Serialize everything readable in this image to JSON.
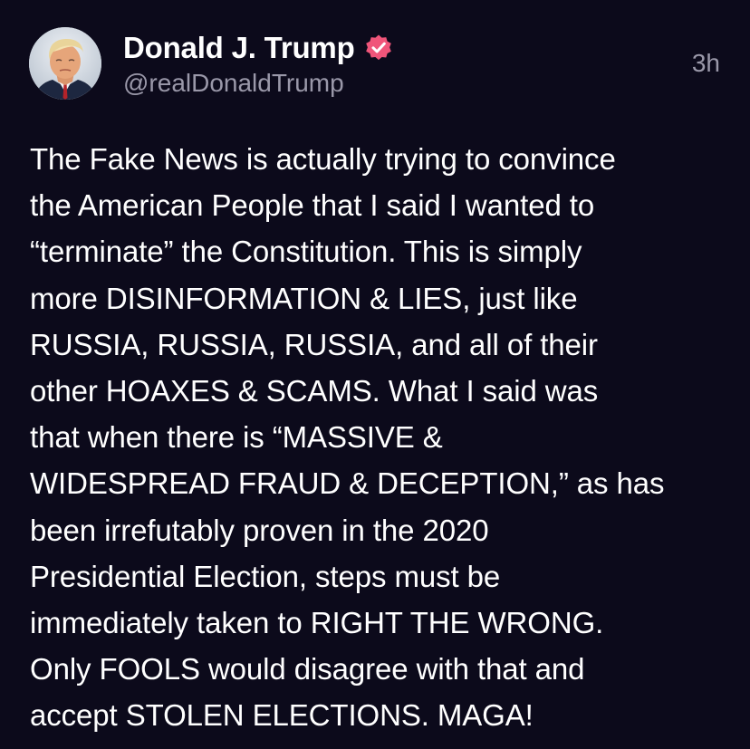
{
  "post": {
    "author": {
      "display_name": "Donald J. Trump",
      "handle": "@realDonaldTrump",
      "verified": true,
      "verified_badge_color": "#f0557a",
      "avatar": "profile-photo"
    },
    "timestamp": "3h",
    "body_lines": [
      "The Fake News is actually trying to convince",
      "the American People that I said I wanted to",
      "“terminate” the Constitution. This is simply",
      "more DISINFORMATION & LIES, just like",
      "RUSSIA, RUSSIA, RUSSIA, and all of their",
      "other HOAXES & SCAMS. What I said was",
      "that when there is “MASSIVE &",
      "WIDESPREAD FRAUD & DECEPTION,” as has",
      "been irrefutably proven in the 2020",
      "Presidential Election, steps must be",
      "immediately taken to RIGHT THE WRONG.",
      "Only FOOLS would disagree with that and",
      "accept STOLEN ELECTIONS. MAGA!"
    ]
  },
  "colors": {
    "background": "#0c0a1b",
    "text_primary": "#ffffff",
    "text_secondary": "#9a98a9"
  }
}
